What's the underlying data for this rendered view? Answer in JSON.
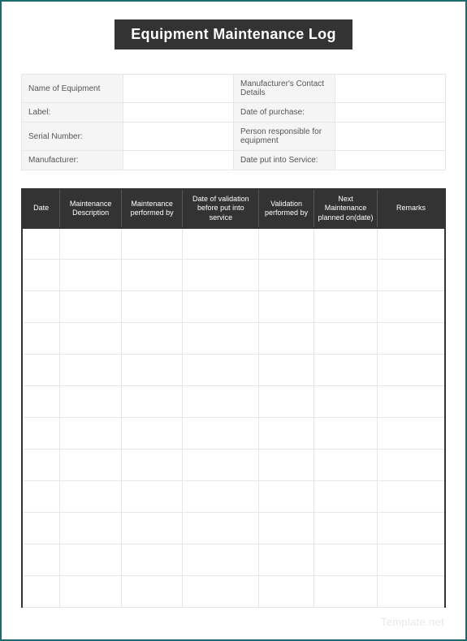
{
  "title": "Equipment Maintenance Log",
  "info": {
    "rows": [
      {
        "left_label": "Name of Equipment",
        "left_value": "",
        "right_label": "Manufacturer's Contact Details",
        "right_value": ""
      },
      {
        "left_label": "Label:",
        "left_value": "",
        "right_label": "Date of purchase:",
        "right_value": ""
      },
      {
        "left_label": "Serial Number:",
        "left_value": "",
        "right_label": "Person responsible for equipment",
        "right_value": ""
      },
      {
        "left_label": "Manufacturer:",
        "left_value": "",
        "right_label": "Date put into Service:",
        "right_value": ""
      }
    ]
  },
  "log": {
    "headers": {
      "date": "Date",
      "desc": "Maintenance Description",
      "mperf": "Maintenance performed by",
      "dval": "Date of validation before put into service",
      "vperf": "Validation performed by",
      "next": "Next Maintenance planned on(date)",
      "remarks": "Remarks"
    },
    "rows": [
      {
        "date": "",
        "desc": "",
        "mperf": "",
        "dval": "",
        "vperf": "",
        "next": "",
        "remarks": ""
      },
      {
        "date": "",
        "desc": "",
        "mperf": "",
        "dval": "",
        "vperf": "",
        "next": "",
        "remarks": ""
      },
      {
        "date": "",
        "desc": "",
        "mperf": "",
        "dval": "",
        "vperf": "",
        "next": "",
        "remarks": ""
      },
      {
        "date": "",
        "desc": "",
        "mperf": "",
        "dval": "",
        "vperf": "",
        "next": "",
        "remarks": ""
      },
      {
        "date": "",
        "desc": "",
        "mperf": "",
        "dval": "",
        "vperf": "",
        "next": "",
        "remarks": ""
      },
      {
        "date": "",
        "desc": "",
        "mperf": "",
        "dval": "",
        "vperf": "",
        "next": "",
        "remarks": ""
      },
      {
        "date": "",
        "desc": "",
        "mperf": "",
        "dval": "",
        "vperf": "",
        "next": "",
        "remarks": ""
      },
      {
        "date": "",
        "desc": "",
        "mperf": "",
        "dval": "",
        "vperf": "",
        "next": "",
        "remarks": ""
      },
      {
        "date": "",
        "desc": "",
        "mperf": "",
        "dval": "",
        "vperf": "",
        "next": "",
        "remarks": ""
      },
      {
        "date": "",
        "desc": "",
        "mperf": "",
        "dval": "",
        "vperf": "",
        "next": "",
        "remarks": ""
      },
      {
        "date": "",
        "desc": "",
        "mperf": "",
        "dval": "",
        "vperf": "",
        "next": "",
        "remarks": ""
      },
      {
        "date": "",
        "desc": "",
        "mperf": "",
        "dval": "",
        "vperf": "",
        "next": "",
        "remarks": ""
      }
    ]
  },
  "watermark": "Template.net"
}
